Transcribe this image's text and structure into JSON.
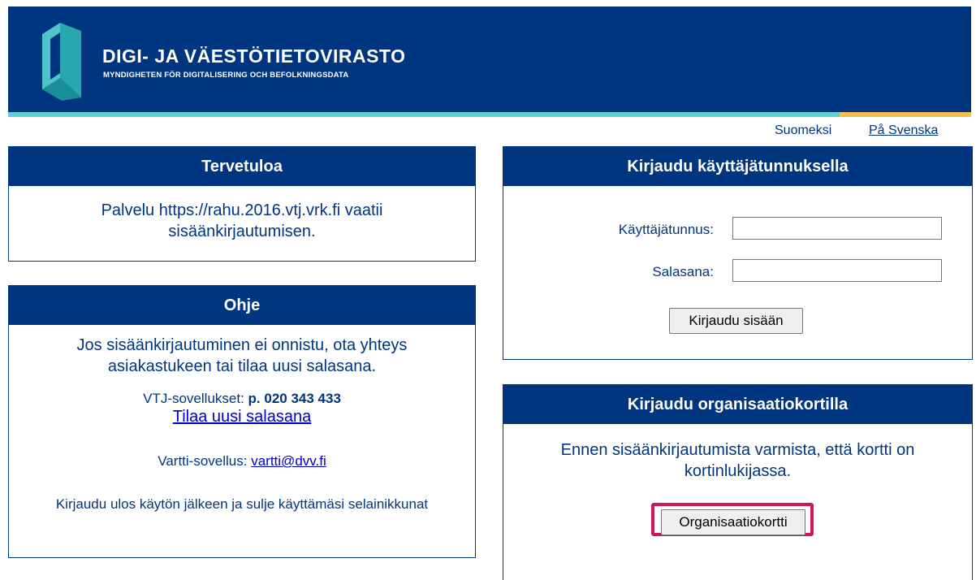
{
  "header": {
    "brand_title": "DIGI- JA VÄESTÖTIETOVIRASTO",
    "brand_subtitle": "MYNDIGHETEN FÖR DIGITALISERING OCH BEFOLKNINGSDATA",
    "logo_icon": "dvv-logo-icon"
  },
  "language": {
    "finnish": "Suomeksi",
    "swedish": "På Svenska"
  },
  "welcome": {
    "title": "Tervetuloa",
    "text": "Palvelu https://rahu.2016.vtj.vrk.fi vaatii sisäänkirjautumisen."
  },
  "help": {
    "title": "Ohje",
    "text": "Jos sisäänkirjautuminen ei onnistu, ota yhteys asiakastukeen tai tilaa uusi salasana.",
    "phone_label": "VTJ-sovellukset: ",
    "phone_number": "p. 020 343 433",
    "new_password_link": "Tilaa uusi salasana",
    "vartti_label": "Vartti-sovellus: ",
    "vartti_email": "vartti@dvv.fi",
    "logout_text": "Kirjaudu ulos käytön jälkeen ja sulje käyttämäsi selainikkunat"
  },
  "login": {
    "title": "Kirjaudu käyttäjätunnuksella",
    "username_label": "Käyttäjätunnus:",
    "username_value": "",
    "password_label": "Salasana:",
    "password_value": "",
    "submit_label": "Kirjaudu sisään"
  },
  "card_login": {
    "title": "Kirjaudu organisaatiokortilla",
    "text": "Ennen sisäänkirjautumista varmista, että kortti on kortinlukijassa.",
    "button_label": "Organisaatiokortti"
  },
  "colors": {
    "brand_blue": "#003580",
    "stripe_teal": "#5fd0d8",
    "stripe_gold": "#f1c04f",
    "highlight": "#d4145a"
  }
}
